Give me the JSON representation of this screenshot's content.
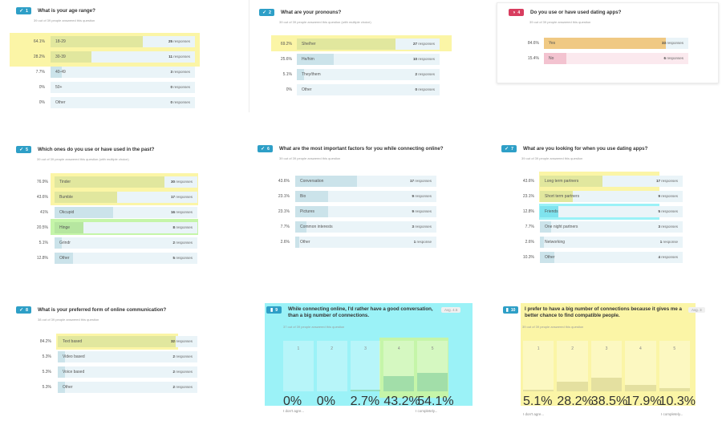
{
  "colors": {
    "accent": "#2e9fc7",
    "pink": "#d83d5f",
    "highlight_yellow": "#fbf5a6",
    "highlight_green": "#c5f5a9",
    "highlight_cyan": "#9bf2f7"
  },
  "q1": {
    "num": "1",
    "title": "What is your age range?",
    "sub": "39 out of 39 people answered this question",
    "options": [
      {
        "pct": "64.1%",
        "label": "18-29",
        "count": "25",
        "word": "responses",
        "share": 0.641,
        "hl": "y"
      },
      {
        "pct": "28.2%",
        "label": "30-39",
        "count": "11",
        "word": "responses",
        "share": 0.282,
        "hl": "y"
      },
      {
        "pct": "7.7%",
        "label": "40-49",
        "count": "3",
        "word": "responses",
        "share": 0.077,
        "hl": ""
      },
      {
        "pct": "0%",
        "label": "50+",
        "count": "0",
        "word": "responses",
        "share": 0,
        "hl": ""
      },
      {
        "pct": "0%",
        "label": "Other",
        "count": "0",
        "word": "responses",
        "share": 0,
        "hl": ""
      }
    ]
  },
  "q2": {
    "num": "2",
    "title": "What are your pronouns?",
    "sub": "39 out of 39 people answered this question (with multiple choice)",
    "options": [
      {
        "pct": "69.2%",
        "label": "She/her",
        "count": "27",
        "word": "responses",
        "share": 0.692,
        "hl": "y"
      },
      {
        "pct": "25.6%",
        "label": "He/him",
        "count": "10",
        "word": "responses",
        "share": 0.256,
        "hl": ""
      },
      {
        "pct": "5.1%",
        "label": "They/them",
        "count": "2",
        "word": "responses",
        "share": 0.051,
        "hl": ""
      },
      {
        "pct": "0%",
        "label": "Other",
        "count": "0",
        "word": "responses",
        "share": 0,
        "hl": ""
      }
    ]
  },
  "q4": {
    "num": "4",
    "title": "Do you use or have used dating apps?",
    "sub": "39 out of 39 people answered this question",
    "options": [
      {
        "pct": "84.6%",
        "label": "Yes",
        "count": "33",
        "word": "responses",
        "share": 0.846,
        "hl": "o"
      },
      {
        "pct": "15.4%",
        "label": "No",
        "count": "6",
        "word": "responses",
        "share": 0.154,
        "hl": "p"
      }
    ]
  },
  "q5": {
    "num": "5",
    "title": "Which ones do you use or have used in the past?",
    "sub": "39 out of 39 people answered this question (with multiple choice)",
    "options": [
      {
        "pct": "76.9%",
        "label": "Tinder",
        "count": "30",
        "word": "responses",
        "share": 0.769,
        "hl": "y"
      },
      {
        "pct": "43.6%",
        "label": "Bumble",
        "count": "17",
        "word": "responses",
        "share": 0.436,
        "hl": "y"
      },
      {
        "pct": "41%",
        "label": "Okcupid",
        "count": "16",
        "word": "responses",
        "share": 0.41,
        "hl": ""
      },
      {
        "pct": "20.5%",
        "label": "Hinge",
        "count": "8",
        "word": "responses",
        "share": 0.205,
        "hl": "g"
      },
      {
        "pct": "5.1%",
        "label": "Grindr",
        "count": "2",
        "word": "responses",
        "share": 0.051,
        "hl": ""
      },
      {
        "pct": "12.8%",
        "label": "Other",
        "count": "5",
        "word": "responses",
        "share": 0.128,
        "hl": ""
      }
    ]
  },
  "q6": {
    "num": "6",
    "title": "What are the most important factors for you while connecting online?",
    "sub": "39 out of 39 people answered this question",
    "options": [
      {
        "pct": "43.6%",
        "label": "Conversation",
        "count": "17",
        "word": "responses",
        "share": 0.436,
        "hl": ""
      },
      {
        "pct": "23.1%",
        "label": "Bio",
        "count": "9",
        "word": "responses",
        "share": 0.231,
        "hl": ""
      },
      {
        "pct": "23.1%",
        "label": "Pictures",
        "count": "9",
        "word": "responses",
        "share": 0.231,
        "hl": ""
      },
      {
        "pct": "7.7%",
        "label": "Common interests",
        "count": "3",
        "word": "responses",
        "share": 0.077,
        "hl": ""
      },
      {
        "pct": "2.6%",
        "label": "Other",
        "count": "1",
        "word": "response",
        "share": 0.026,
        "hl": ""
      }
    ]
  },
  "q7": {
    "num": "7",
    "title": "What are you looking for when you use dating apps?",
    "sub": "39 out of 39 people answered this question",
    "options": [
      {
        "pct": "43.6%",
        "label": "Long term partners",
        "count": "17",
        "word": "responses",
        "share": 0.436,
        "hl": "y"
      },
      {
        "pct": "23.1%",
        "label": "Short term partners",
        "count": "9",
        "word": "responses",
        "share": 0.231,
        "hl": "y"
      },
      {
        "pct": "12.8%",
        "label": "Friends",
        "count": "5",
        "word": "responses",
        "share": 0.128,
        "hl": "c"
      },
      {
        "pct": "7.7%",
        "label": "One night partners",
        "count": "3",
        "word": "responses",
        "share": 0.077,
        "hl": ""
      },
      {
        "pct": "2.6%",
        "label": "Networking",
        "count": "1",
        "word": "response",
        "share": 0.026,
        "hl": ""
      },
      {
        "pct": "10.3%",
        "label": "Other",
        "count": "4",
        "word": "responses",
        "share": 0.103,
        "hl": ""
      }
    ]
  },
  "q8": {
    "num": "8",
    "title": "What is your preferred form of online communication?",
    "sub": "38 out of 39 people answered this question",
    "options": [
      {
        "pct": "84.2%",
        "label": "Text based",
        "count": "32",
        "word": "responses",
        "share": 0.842,
        "hl": "y"
      },
      {
        "pct": "5.3%",
        "label": "Video based",
        "count": "2",
        "word": "responses",
        "share": 0.053,
        "hl": ""
      },
      {
        "pct": "5.3%",
        "label": "Voice based",
        "count": "2",
        "word": "responses",
        "share": 0.053,
        "hl": ""
      },
      {
        "pct": "5.3%",
        "label": "Other",
        "count": "2",
        "word": "responses",
        "share": 0.053,
        "hl": ""
      }
    ]
  },
  "q9": {
    "num": "9",
    "title": "While connecting online, I'd rather have a good conversation, than a big number of connections.",
    "sub": "37 out of 39 people answered this question",
    "avg": "Avg. 4.5",
    "scale": [
      {
        "n": "1",
        "pct": "0%",
        "share": 0
      },
      {
        "n": "2",
        "pct": "0%",
        "share": 0
      },
      {
        "n": "3",
        "pct": "2.7%",
        "share": 0.027
      },
      {
        "n": "4",
        "pct": "43.2%",
        "share": 0.432
      },
      {
        "n": "5",
        "pct": "54.1%",
        "share": 0.541
      }
    ],
    "left_label": "I don't agre...",
    "right_label": "I completely..."
  },
  "q10": {
    "num": "10",
    "title": "I prefer to have a big number of connections because it gives me a better chance to find compatible people.",
    "sub": "39 out of 39 people answered this question",
    "avg": "Avg. 3",
    "scale": [
      {
        "n": "1",
        "pct": "5.1%",
        "share": 0.051
      },
      {
        "n": "2",
        "pct": "28.2%",
        "share": 0.282
      },
      {
        "n": "3",
        "pct": "38.5%",
        "share": 0.385
      },
      {
        "n": "4",
        "pct": "17.9%",
        "share": 0.179
      },
      {
        "n": "5",
        "pct": "10.3%",
        "share": 0.103
      }
    ],
    "left_label": "I don't agre...",
    "right_label": "I completely..."
  }
}
